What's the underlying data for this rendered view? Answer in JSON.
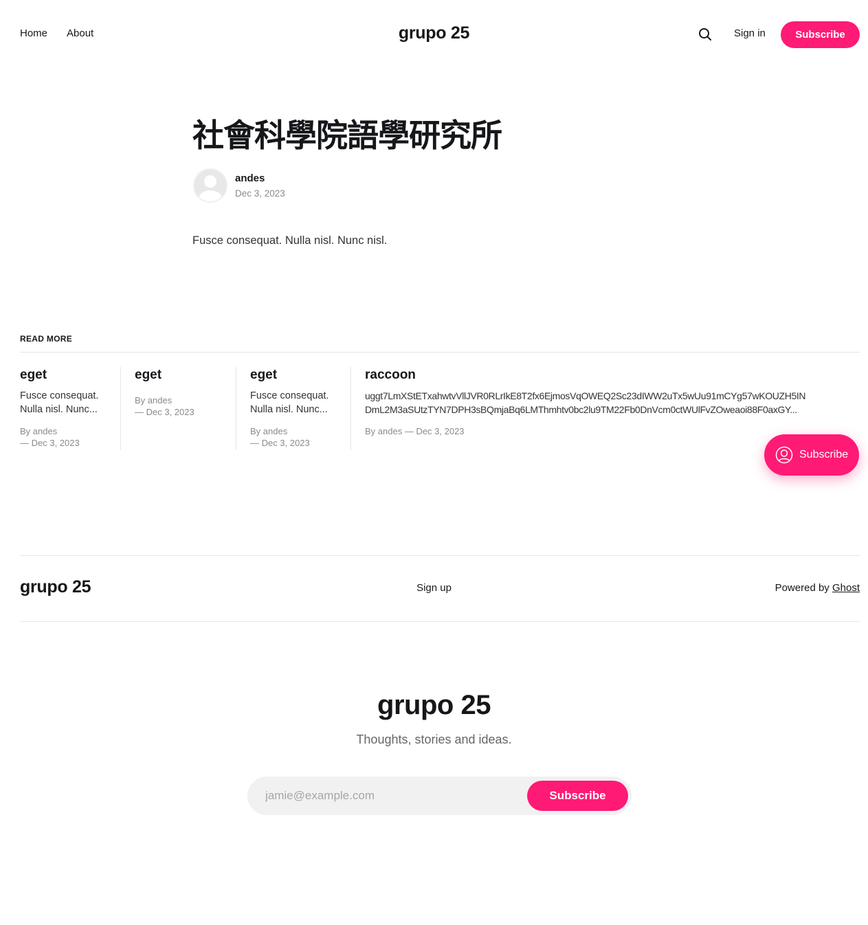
{
  "header": {
    "nav": [
      {
        "label": "Home"
      },
      {
        "label": "About"
      }
    ],
    "brand": "grupo 25",
    "search_icon": "search-icon",
    "sign_in": "Sign in",
    "subscribe": "Subscribe"
  },
  "colors": {
    "accent": "#ff1a75",
    "text": "#15171a",
    "muted": "#8a8a8a"
  },
  "article": {
    "title": "社會科學院語學研究所",
    "author": "andes",
    "date": "Dec 3, 2023",
    "body": "Fusce consequat. Nulla nisl. Nunc nisl."
  },
  "read_more": {
    "label": "READ MORE",
    "cards": [
      {
        "title": "eget",
        "excerpt_1": "Fusce consequat.",
        "excerpt_2": "Nulla nisl. Nunc...",
        "meta_1": "By andes",
        "meta_2": "— Dec 3, 2023"
      },
      {
        "title": "eget",
        "excerpt_1": "",
        "excerpt_2": "",
        "meta_1": "By andes",
        "meta_2": "— Dec 3, 2023"
      },
      {
        "title": "eget",
        "excerpt_1": "Fusce consequat.",
        "excerpt_2": "Nulla nisl. Nunc...",
        "meta_1": "By andes",
        "meta_2": "— Dec 3, 2023"
      },
      {
        "title": "raccoon",
        "excerpt_1": "uggt7LmXStETxahwtvVllJVR0RLrIkE8T2fx6EjmosVqOWEQ2Sc23dIWW2uTx5wUu91mCYg57wKOUZH5IN",
        "excerpt_2": "DmL2M3aSUtzTYN7DPH3sBQmjaBq6LMThmhtv0bc2lu9TM22Fb0DnVcm0ctWUlFvZOweaoi88F0axGY...",
        "meta_1": "By andes — Dec 3, 2023",
        "meta_2": ""
      }
    ]
  },
  "portal": {
    "label": "Subscribe",
    "icon": "user-circle-icon"
  },
  "footer": {
    "brand": "grupo 25",
    "sign_up": "Sign up",
    "powered_prefix": "Powered by ",
    "powered_link": "Ghost"
  },
  "cta": {
    "title": "grupo 25",
    "description": "Thoughts, stories and ideas.",
    "input_placeholder": "jamie@example.com",
    "button": "Subscribe"
  }
}
